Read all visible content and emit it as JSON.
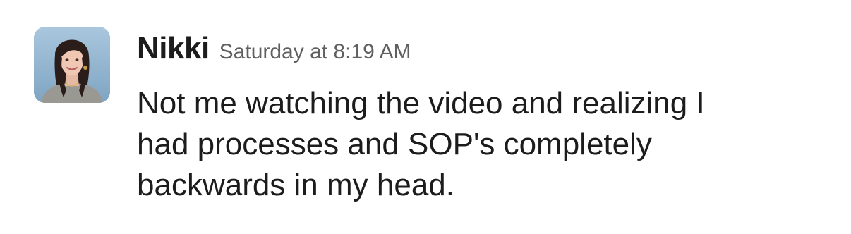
{
  "message": {
    "sender": "Nikki",
    "timestamp": "Saturday at 8:19 AM",
    "lines": [
      "Not me watching the video and realizing I",
      "had processes and SOP's completely",
      "backwards in my head."
    ],
    "avatar_icon": "user-photo-avatar"
  },
  "colors": {
    "text": "#1d1c1d",
    "timestamp": "#616061",
    "avatar_background": "#8fb3cf"
  }
}
